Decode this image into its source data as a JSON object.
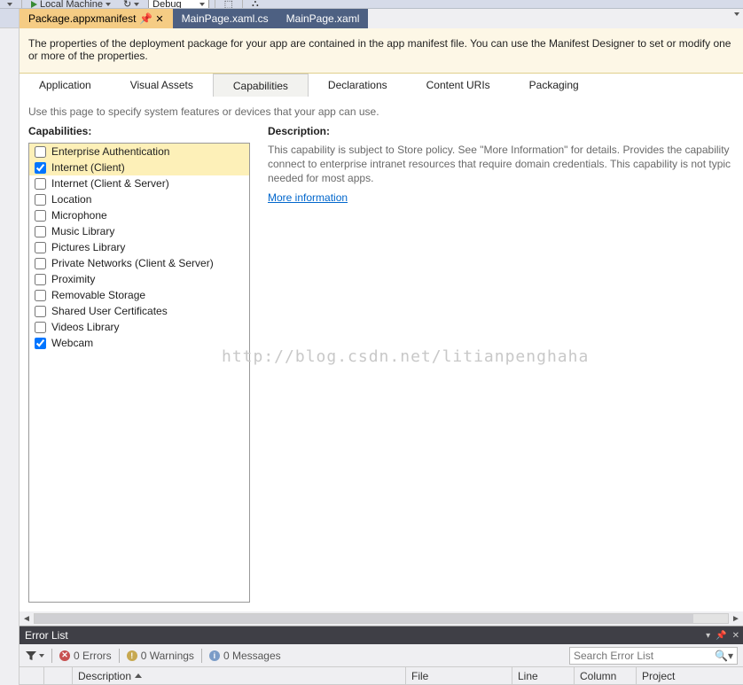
{
  "toolbar": {
    "launch_label": "Local Machine",
    "config_label": "Debug"
  },
  "tabs": [
    {
      "label": "Package.appxmanifest",
      "active": true
    },
    {
      "label": "MainPage.xaml.cs",
      "active": false
    },
    {
      "label": "MainPage.xaml",
      "active": false
    }
  ],
  "manifest": {
    "info": "The properties of the deployment package for your app are contained in the app manifest file. You can use the Manifest Designer to set or modify one or more of the properties.",
    "tabs": {
      "application": "Application",
      "visual_assets": "Visual Assets",
      "capabilities": "Capabilities",
      "declarations": "Declarations",
      "content_uris": "Content URIs",
      "packaging": "Packaging"
    },
    "sub_note": "Use this page to specify system features or devices that your app can use.",
    "cap_heading": "Capabilities:",
    "desc_heading": "Description:",
    "capabilities": [
      {
        "label": "Enterprise Authentication",
        "checked": false,
        "selected": true
      },
      {
        "label": "Internet (Client)",
        "checked": true,
        "selected": true
      },
      {
        "label": "Internet (Client & Server)",
        "checked": false,
        "selected": false
      },
      {
        "label": "Location",
        "checked": false,
        "selected": false
      },
      {
        "label": "Microphone",
        "checked": false,
        "selected": false
      },
      {
        "label": "Music Library",
        "checked": false,
        "selected": false
      },
      {
        "label": "Pictures Library",
        "checked": false,
        "selected": false
      },
      {
        "label": "Private Networks (Client & Server)",
        "checked": false,
        "selected": false
      },
      {
        "label": "Proximity",
        "checked": false,
        "selected": false
      },
      {
        "label": "Removable Storage",
        "checked": false,
        "selected": false
      },
      {
        "label": "Shared User Certificates",
        "checked": false,
        "selected": false
      },
      {
        "label": "Videos Library",
        "checked": false,
        "selected": false
      },
      {
        "label": "Webcam",
        "checked": true,
        "selected": false
      }
    ],
    "description_text": "This capability is subject to Store policy. See \"More Information\" for details. Provides the capability connect to enterprise intranet resources that require domain credentials. This capability is not typic needed for most apps.",
    "more_info": "More information"
  },
  "error_list": {
    "title": "Error List",
    "errors": "0 Errors",
    "warnings": "0 Warnings",
    "messages": "0 Messages",
    "search_placeholder": "Search Error List",
    "cols": {
      "description": "Description",
      "file": "File",
      "line": "Line",
      "column": "Column",
      "project": "Project"
    }
  },
  "watermark": "http://blog.csdn.net/litianpenghaha"
}
